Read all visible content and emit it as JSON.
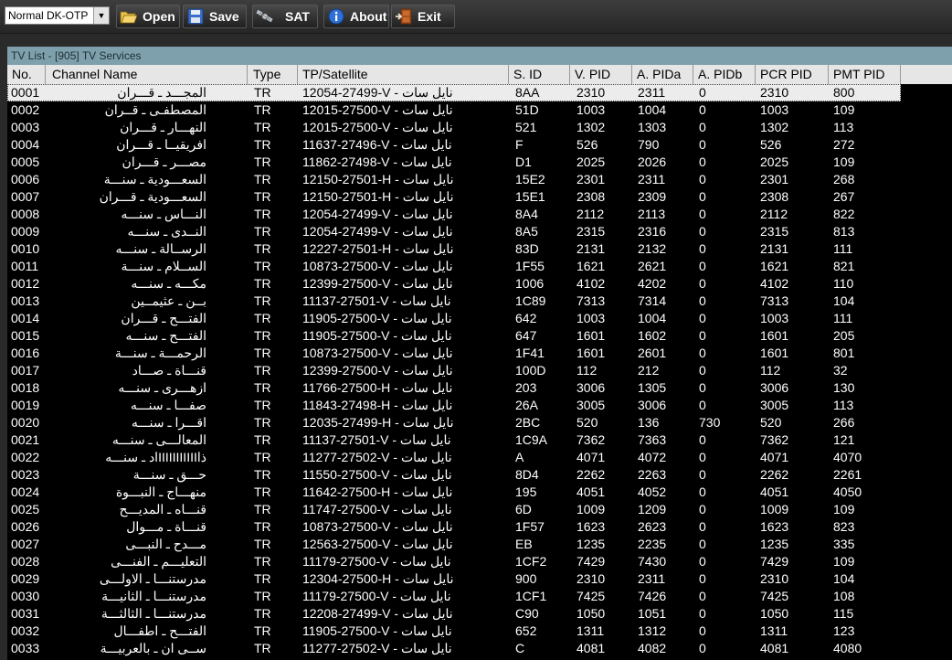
{
  "toolbar": {
    "mode_value": "Normal DK-OTP",
    "open_label": "Open",
    "save_label": "Save",
    "sat_label": "SAT",
    "about_label": "About",
    "exit_label": "Exit"
  },
  "panel": {
    "title": "TV List - [905] TV Services"
  },
  "columns": [
    "No.",
    "Channel Name",
    "Type",
    "TP/Satellite",
    "S. ID",
    "V. PID",
    "A. PIDa",
    "A. PIDb",
    "PCR PID",
    "PMT PID"
  ],
  "rows": [
    [
      "0001",
      "المجـــد ـ قـــران",
      "TR",
      "12054-27499-V - نايل سات",
      "8AA",
      "2310",
      "2311",
      "0",
      "2310",
      "800"
    ],
    [
      "0002",
      "المصطفـى ـ قــران",
      "TR",
      "12015-27500-V - نايل سات",
      "51D",
      "1003",
      "1004",
      "0",
      "1003",
      "109"
    ],
    [
      "0003",
      "النهـــار ـ قـــران",
      "TR",
      "12015-27500-V - نايل سات",
      "521",
      "1302",
      "1303",
      "0",
      "1302",
      "113"
    ],
    [
      "0004",
      "افريقيــا ـ قـــران",
      "TR",
      "11637-27496-V - نايل سات",
      "F",
      "526",
      "790",
      "0",
      "526",
      "272"
    ],
    [
      "0005",
      "مصـــر ـ قـــران",
      "TR",
      "11862-27498-V - نايل سات",
      "D1",
      "2025",
      "2026",
      "0",
      "2025",
      "109"
    ],
    [
      "0006",
      "السعـــودية ـ سنـــة",
      "TR",
      "12150-27501-H - نايل سات",
      "15E2",
      "2301",
      "2311",
      "0",
      "2301",
      "268"
    ],
    [
      "0007",
      "السعـــودية ـ قـــران",
      "TR",
      "12150-27501-H - نايل سات",
      "15E1",
      "2308",
      "2309",
      "0",
      "2308",
      "267"
    ],
    [
      "0008",
      "النـــاس ـ سنـــه",
      "TR",
      "12054-27499-V - نايل سات",
      "8A4",
      "2112",
      "2113",
      "0",
      "2112",
      "822"
    ],
    [
      "0009",
      "النــدى ـ سنـــه",
      "TR",
      "12054-27499-V - نايل سات",
      "8A5",
      "2315",
      "2316",
      "0",
      "2315",
      "813"
    ],
    [
      "0010",
      "الرســالة ـ سنـــه",
      "TR",
      "12227-27501-H - نايل سات",
      "83D",
      "2131",
      "2132",
      "0",
      "2131",
      "111"
    ],
    [
      "0011",
      "الســلام ـ سنـــة",
      "TR",
      "10873-27500-V - نايل سات",
      "1F55",
      "1621",
      "2621",
      "0",
      "1621",
      "821"
    ],
    [
      "0012",
      "مكـــه ـ سنـــه",
      "TR",
      "12399-27500-V - نايل سات",
      "1006",
      "4102",
      "4202",
      "0",
      "4102",
      "110"
    ],
    [
      "0013",
      "بــن ـ عثيمــين",
      "TR",
      "11137-27501-V - نايل سات",
      "1C89",
      "7313",
      "7314",
      "0",
      "7313",
      "104"
    ],
    [
      "0014",
      "الفتـــح ـ قـــران",
      "TR",
      "11905-27500-V - نايل سات",
      "642",
      "1003",
      "1004",
      "0",
      "1003",
      "111"
    ],
    [
      "0015",
      "الفتـــح ـ سنـــه",
      "TR",
      "11905-27500-V - نايل سات",
      "647",
      "1601",
      "1602",
      "0",
      "1601",
      "205"
    ],
    [
      "0016",
      "الرحمـــة ـ سنـــة",
      "TR",
      "10873-27500-V - نايل سات",
      "1F41",
      "1601",
      "2601",
      "0",
      "1601",
      "801"
    ],
    [
      "0017",
      "قنـــاة ـ صـــاد",
      "TR",
      "12399-27500-V - نايل سات",
      "100D",
      "112",
      "212",
      "0",
      "112",
      "32"
    ],
    [
      "0018",
      "ازهـــرى ـ سنـــه",
      "TR",
      "11766-27500-H - نايل سات",
      "203",
      "3006",
      "1305",
      "0",
      "3006",
      "130"
    ],
    [
      "0019",
      "صفـــا ـ سنـــه",
      "TR",
      "11843-27498-H - نايل سات",
      "26A",
      "3005",
      "3006",
      "0",
      "3005",
      "113"
    ],
    [
      "0020",
      "اقـــرا ـ سنـــه",
      "TR",
      "12035-27499-H - نايل سات",
      "2BC",
      "520",
      "136",
      "730",
      "520",
      "266"
    ],
    [
      "0021",
      "المعالـــى ـ سنـــه",
      "TR",
      "11137-27501-V - نايل سات",
      "1C9A",
      "7362",
      "7363",
      "0",
      "7362",
      "121"
    ],
    [
      "0022",
      "ذاIIIIIIIIIIIاد ـ سنـــه",
      "TR",
      "11277-27502-V - نايل سات",
      "A",
      "4071",
      "4072",
      "0",
      "4071",
      "4070"
    ],
    [
      "0023",
      "حـــق ـ سنـــة",
      "TR",
      "11550-27500-V - نايل سات",
      "8D4",
      "2262",
      "2263",
      "0",
      "2262",
      "2261"
    ],
    [
      "0024",
      "منهـــاج ـ النبـــوة",
      "TR",
      "11642-27500-H - نايل سات",
      "195",
      "4051",
      "4052",
      "0",
      "4051",
      "4050"
    ],
    [
      "0025",
      "قنـــاه ـ المديـــح",
      "TR",
      "11747-27500-V - نايل سات",
      "6D",
      "1009",
      "1209",
      "0",
      "1009",
      "109"
    ],
    [
      "0026",
      "قنـــاة ـ مـــوال",
      "TR",
      "10873-27500-V - نايل سات",
      "1F57",
      "1623",
      "2623",
      "0",
      "1623",
      "823"
    ],
    [
      "0027",
      "مـــدح ـ النبـــى",
      "TR",
      "12563-27500-V - نايل سات",
      "EB",
      "1235",
      "2235",
      "0",
      "1235",
      "335"
    ],
    [
      "0028",
      "التعليـــم ـ الفنـــى",
      "TR",
      "11179-27500-V - نايل سات",
      "1CF2",
      "7429",
      "7430",
      "0",
      "7429",
      "109"
    ],
    [
      "0029",
      "مدرستنـــا ـ الاولـــى",
      "TR",
      "12304-27500-H - نايل سات",
      "900",
      "2310",
      "2311",
      "0",
      "2310",
      "104"
    ],
    [
      "0030",
      "مدرستنـــا ـ الثانيـــة",
      "TR",
      "11179-27500-V - نايل سات",
      "1CF1",
      "7425",
      "7426",
      "0",
      "7425",
      "108"
    ],
    [
      "0031",
      "مدرستنـــا ـ الثالثـــة",
      "TR",
      "12208-27499-V - نايل سات",
      "C90",
      "1050",
      "1051",
      "0",
      "1050",
      "115"
    ],
    [
      "0032",
      "الفتـــح ـ اطفـــال",
      "TR",
      "11905-27500-V - نايل سات",
      "652",
      "1311",
      "1312",
      "0",
      "1311",
      "123"
    ],
    [
      "0033",
      "ســى ان ـ بالعربيـــة",
      "TR",
      "11277-27502-V - نايل سات",
      "C",
      "4081",
      "4082",
      "0",
      "4081",
      "4080"
    ]
  ]
}
